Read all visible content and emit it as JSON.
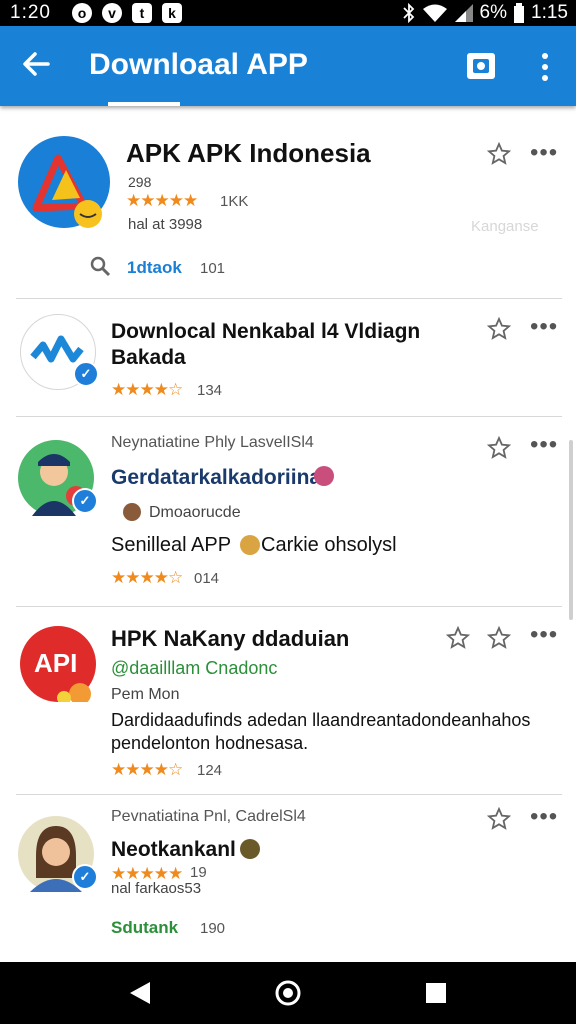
{
  "status": {
    "time": "1:20",
    "battery_text": "6%",
    "right_time": "1:15"
  },
  "appbar": {
    "title": "Downloaal APP",
    "color": "#1a82d6"
  },
  "items": [
    {
      "title": "APK APK Indonesia",
      "line1": "298",
      "rating_text": "1KK",
      "line3": "hal at 3998",
      "search_label": "1dtaok",
      "search_count": "101",
      "faint": "Kanganse"
    },
    {
      "title_line1": "Downlocal Nenkabal l4 Vldiagn",
      "title_line2": "Bakada",
      "count": "134"
    },
    {
      "subtitle": "Neynatiatine Phly LasvelISl4",
      "title": "Gerdatarkalkadoriina",
      "meta": "Dmoaorucde",
      "desc": "Senilleal APP",
      "desc2": "Carkie ohsolysl",
      "count": "014"
    },
    {
      "title": "HPK NaKany ddaduian",
      "link": "@daailllam Cnadonc",
      "meta": "Pem Mon",
      "desc1": "Dardidaadufinds adedan llaandreantadondeanhahos",
      "desc2": "pendelonton  hodnesasa.",
      "count": "124"
    },
    {
      "subtitle": "Pevnatiatina Pnl, CadrelSl4",
      "title": "Neotkankanl",
      "count_small": "19",
      "line": "nal farkaos53",
      "green_label": "Sdutank",
      "green_count": "190"
    }
  ],
  "icons": {
    "back": "back-arrow-icon",
    "screenshot": "screenshot-icon",
    "more": "more-vert-icon",
    "star": "star-outline-icon",
    "dots": "more-horiz-icon"
  }
}
